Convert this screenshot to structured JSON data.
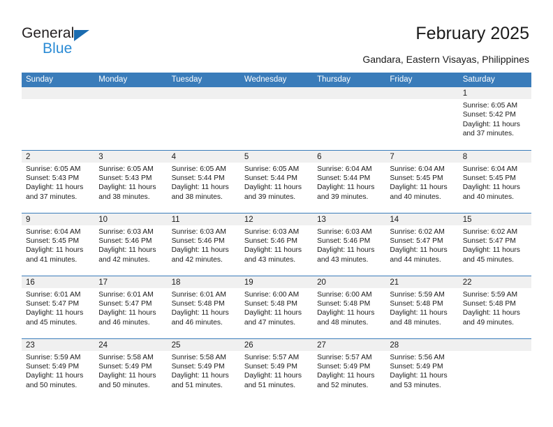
{
  "brand": {
    "name_part1": "General",
    "name_part2": "Blue",
    "logo_icon": "triangle-flag-icon",
    "accent_color": "#2a8bd5",
    "dark_color": "#231f20"
  },
  "header": {
    "title": "February 2025",
    "subtitle": "Gandara, Eastern Visayas, Philippines"
  },
  "theme": {
    "header_row_bg": "#3a7cba",
    "header_row_text": "#ffffff",
    "daynum_band_bg": "#f0f0f0",
    "row_divider": "#3a7cba"
  },
  "weekday_headers": [
    "Sunday",
    "Monday",
    "Tuesday",
    "Wednesday",
    "Thursday",
    "Friday",
    "Saturday"
  ],
  "labels": {
    "sunrise": "Sunrise:",
    "sunset": "Sunset:",
    "daylight": "Daylight:"
  },
  "weeks": [
    [
      {
        "day": "",
        "empty": true
      },
      {
        "day": "",
        "empty": true
      },
      {
        "day": "",
        "empty": true
      },
      {
        "day": "",
        "empty": true
      },
      {
        "day": "",
        "empty": true
      },
      {
        "day": "",
        "empty": true
      },
      {
        "day": "1",
        "sunrise": "Sunrise: 6:05 AM",
        "sunset": "Sunset: 5:42 PM",
        "daylight": "Daylight: 11 hours and 37 minutes."
      }
    ],
    [
      {
        "day": "2",
        "sunrise": "Sunrise: 6:05 AM",
        "sunset": "Sunset: 5:43 PM",
        "daylight": "Daylight: 11 hours and 37 minutes."
      },
      {
        "day": "3",
        "sunrise": "Sunrise: 6:05 AM",
        "sunset": "Sunset: 5:43 PM",
        "daylight": "Daylight: 11 hours and 38 minutes."
      },
      {
        "day": "4",
        "sunrise": "Sunrise: 6:05 AM",
        "sunset": "Sunset: 5:44 PM",
        "daylight": "Daylight: 11 hours and 38 minutes."
      },
      {
        "day": "5",
        "sunrise": "Sunrise: 6:05 AM",
        "sunset": "Sunset: 5:44 PM",
        "daylight": "Daylight: 11 hours and 39 minutes."
      },
      {
        "day": "6",
        "sunrise": "Sunrise: 6:04 AM",
        "sunset": "Sunset: 5:44 PM",
        "daylight": "Daylight: 11 hours and 39 minutes."
      },
      {
        "day": "7",
        "sunrise": "Sunrise: 6:04 AM",
        "sunset": "Sunset: 5:45 PM",
        "daylight": "Daylight: 11 hours and 40 minutes."
      },
      {
        "day": "8",
        "sunrise": "Sunrise: 6:04 AM",
        "sunset": "Sunset: 5:45 PM",
        "daylight": "Daylight: 11 hours and 40 minutes."
      }
    ],
    [
      {
        "day": "9",
        "sunrise": "Sunrise: 6:04 AM",
        "sunset": "Sunset: 5:45 PM",
        "daylight": "Daylight: 11 hours and 41 minutes."
      },
      {
        "day": "10",
        "sunrise": "Sunrise: 6:03 AM",
        "sunset": "Sunset: 5:46 PM",
        "daylight": "Daylight: 11 hours and 42 minutes."
      },
      {
        "day": "11",
        "sunrise": "Sunrise: 6:03 AM",
        "sunset": "Sunset: 5:46 PM",
        "daylight": "Daylight: 11 hours and 42 minutes."
      },
      {
        "day": "12",
        "sunrise": "Sunrise: 6:03 AM",
        "sunset": "Sunset: 5:46 PM",
        "daylight": "Daylight: 11 hours and 43 minutes."
      },
      {
        "day": "13",
        "sunrise": "Sunrise: 6:03 AM",
        "sunset": "Sunset: 5:46 PM",
        "daylight": "Daylight: 11 hours and 43 minutes."
      },
      {
        "day": "14",
        "sunrise": "Sunrise: 6:02 AM",
        "sunset": "Sunset: 5:47 PM",
        "daylight": "Daylight: 11 hours and 44 minutes."
      },
      {
        "day": "15",
        "sunrise": "Sunrise: 6:02 AM",
        "sunset": "Sunset: 5:47 PM",
        "daylight": "Daylight: 11 hours and 45 minutes."
      }
    ],
    [
      {
        "day": "16",
        "sunrise": "Sunrise: 6:01 AM",
        "sunset": "Sunset: 5:47 PM",
        "daylight": "Daylight: 11 hours and 45 minutes."
      },
      {
        "day": "17",
        "sunrise": "Sunrise: 6:01 AM",
        "sunset": "Sunset: 5:47 PM",
        "daylight": "Daylight: 11 hours and 46 minutes."
      },
      {
        "day": "18",
        "sunrise": "Sunrise: 6:01 AM",
        "sunset": "Sunset: 5:48 PM",
        "daylight": "Daylight: 11 hours and 46 minutes."
      },
      {
        "day": "19",
        "sunrise": "Sunrise: 6:00 AM",
        "sunset": "Sunset: 5:48 PM",
        "daylight": "Daylight: 11 hours and 47 minutes."
      },
      {
        "day": "20",
        "sunrise": "Sunrise: 6:00 AM",
        "sunset": "Sunset: 5:48 PM",
        "daylight": "Daylight: 11 hours and 48 minutes."
      },
      {
        "day": "21",
        "sunrise": "Sunrise: 5:59 AM",
        "sunset": "Sunset: 5:48 PM",
        "daylight": "Daylight: 11 hours and 48 minutes."
      },
      {
        "day": "22",
        "sunrise": "Sunrise: 5:59 AM",
        "sunset": "Sunset: 5:48 PM",
        "daylight": "Daylight: 11 hours and 49 minutes."
      }
    ],
    [
      {
        "day": "23",
        "sunrise": "Sunrise: 5:59 AM",
        "sunset": "Sunset: 5:49 PM",
        "daylight": "Daylight: 11 hours and 50 minutes."
      },
      {
        "day": "24",
        "sunrise": "Sunrise: 5:58 AM",
        "sunset": "Sunset: 5:49 PM",
        "daylight": "Daylight: 11 hours and 50 minutes."
      },
      {
        "day": "25",
        "sunrise": "Sunrise: 5:58 AM",
        "sunset": "Sunset: 5:49 PM",
        "daylight": "Daylight: 11 hours and 51 minutes."
      },
      {
        "day": "26",
        "sunrise": "Sunrise: 5:57 AM",
        "sunset": "Sunset: 5:49 PM",
        "daylight": "Daylight: 11 hours and 51 minutes."
      },
      {
        "day": "27",
        "sunrise": "Sunrise: 5:57 AM",
        "sunset": "Sunset: 5:49 PM",
        "daylight": "Daylight: 11 hours and 52 minutes."
      },
      {
        "day": "28",
        "sunrise": "Sunrise: 5:56 AM",
        "sunset": "Sunset: 5:49 PM",
        "daylight": "Daylight: 11 hours and 53 minutes."
      },
      {
        "day": "",
        "empty": true
      }
    ]
  ]
}
